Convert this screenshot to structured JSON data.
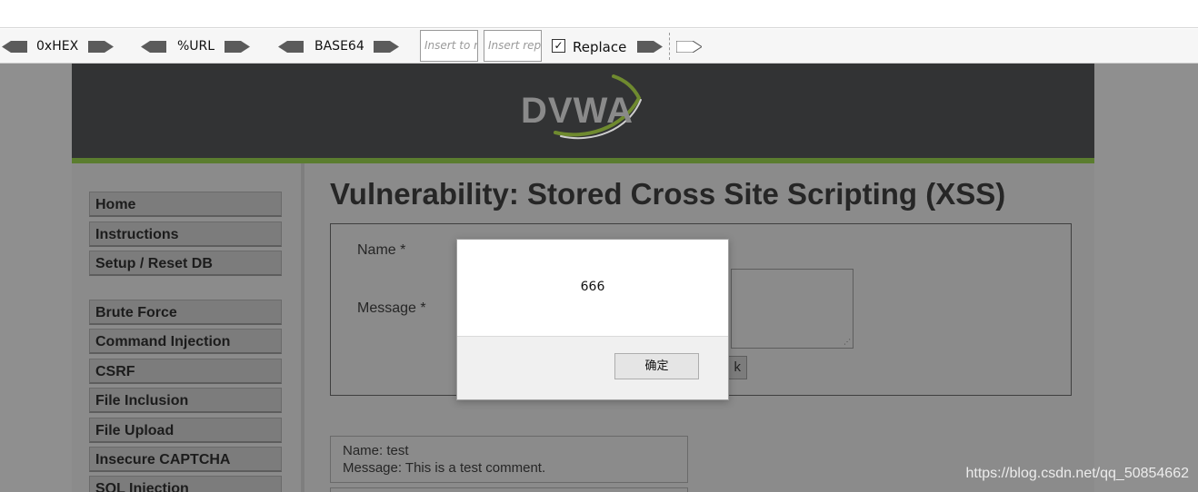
{
  "hackbar": {
    "hex_label": "0xHEX",
    "url_label": "%URL",
    "base64_label": "BASE64",
    "insert_to_placeholder": "Insert to r",
    "insert_rep_placeholder": "Insert rep",
    "replace_label": "Replace",
    "replace_checked": "✓"
  },
  "logo_text": "DVWA",
  "menu": {
    "items": [
      "Home",
      "Instructions",
      "Setup / Reset DB",
      "Brute Force",
      "Command Injection",
      "CSRF",
      "File Inclusion",
      "File Upload",
      "Insecure CAPTCHA",
      "SQL Injection"
    ]
  },
  "main": {
    "title": "Vulnerability: Stored Cross Site Scripting (XSS)",
    "name_label": "Name *",
    "message_label": "Message *",
    "button_fragment": "k",
    "comment": {
      "name": "Name: test",
      "message": "Message: This is a test comment."
    }
  },
  "dialog": {
    "message": "666",
    "ok_label": "确定"
  },
  "watermark": "https://blog.csdn.net/qq_50854662",
  "colors": {
    "header": "#323334",
    "header_bar": "#5b7d2f",
    "backdrop": "#8f8f8f"
  }
}
